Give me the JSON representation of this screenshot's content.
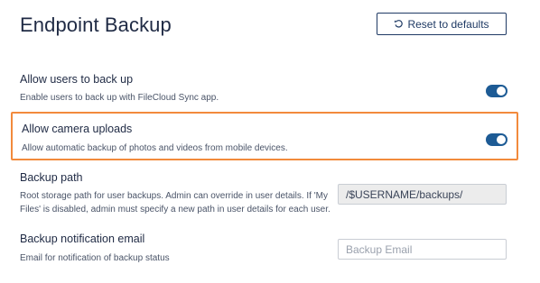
{
  "page": {
    "title": "Endpoint Backup"
  },
  "toolbar": {
    "reset_label": "Reset to defaults"
  },
  "settings": {
    "allow_backup": {
      "label": "Allow users to back up",
      "description": "Enable users to back up with FileCloud Sync app.",
      "enabled": true
    },
    "allow_camera": {
      "label": "Allow camera uploads",
      "description": "Allow automatic backup of photos and videos from mobile devices.",
      "enabled": true
    },
    "backup_path": {
      "label": "Backup path",
      "description_line1": "Root storage path for user backups. Admin can override in user details. If 'My",
      "description_line2": "Files' is disabled, admin must specify a new path in user details for each user.",
      "value": "/$USERNAME/backups/"
    },
    "notification_email": {
      "label": "Backup notification email",
      "description": "Email for notification of backup status",
      "value": "",
      "placeholder": "Backup Email"
    }
  },
  "colors": {
    "accent": "#1d5b95",
    "highlight": "#f28a3c",
    "title": "#1f2a44"
  }
}
